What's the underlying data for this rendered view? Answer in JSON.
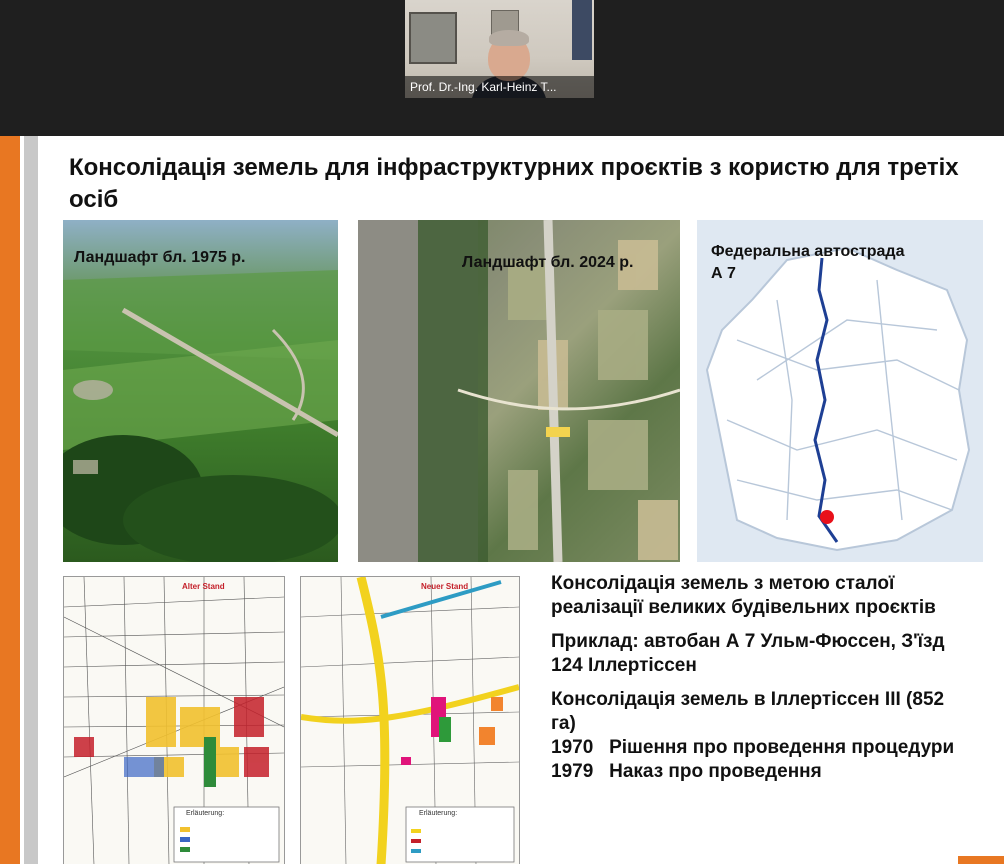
{
  "video": {
    "participant_name": "Prof. Dr.-Ing. Karl-Heinz T..."
  },
  "slide": {
    "title": "Консолідація земель для інфраструктурних проєктів з користю для третіх осіб",
    "photo_1975_label": "Ландшафт бл. 1975 р.",
    "photo_2024_label": "Ландшафт бл. 2024 р.",
    "map_label_line1": "Федеральна автострада",
    "map_label_line2": "А 7",
    "plan_old_title": "Alter Stand",
    "plan_new_title": "Neuer Stand",
    "plan_legend_title": "Erläuterung:",
    "paragraph_1": "Консолідація земель з метою сталої реалізації великих будівельних проєктів",
    "paragraph_2": "Приклад: автобан А 7 Ульм-Фюссен, З'їзд 124 Іллертіссен",
    "paragraph_3": "Консолідація земель в Іллертіссен III (852 га)",
    "paragraph_4": "1970   Рішення про проведення процедури",
    "paragraph_5": "1979   Наказ про проведення"
  },
  "colors": {
    "accent_orange": "#e87722",
    "highway_blue": "#1e3f94",
    "marker_red": "#e8101a"
  }
}
